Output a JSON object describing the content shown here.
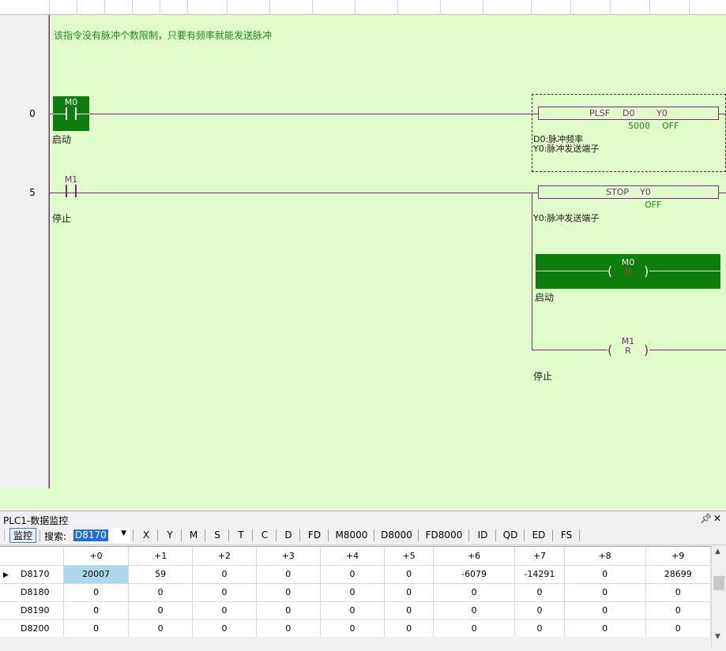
{
  "ladder": {
    "header_comment": "该指令没有脉冲个数限制，只要有频率就能发送脉冲",
    "rungs": [
      {
        "step": "0",
        "contact": {
          "name": "M0",
          "comment": "启动"
        },
        "instruction": {
          "op": "PLSF",
          "arg1": "D0",
          "arg2": "Y0",
          "val1": "5000",
          "val2": "OFF"
        },
        "comments": [
          "D0:脉冲频率",
          "Y0:脉冲发送端子"
        ]
      },
      {
        "step": "5",
        "contact": {
          "name": "M1",
          "comment": "停止"
        },
        "instruction": {
          "op": "STOP",
          "arg1": "Y0",
          "val1": "OFF"
        },
        "comments": [
          "Y0:脉冲发送端子"
        ],
        "coils": [
          {
            "name": "M0",
            "type": "R",
            "comment": "启动"
          },
          {
            "name": "M1",
            "type": "R",
            "comment": "停止"
          }
        ]
      }
    ]
  },
  "monitor": {
    "title": "PLC1-数据监控",
    "pin_icon": "pin-icon",
    "close_icon": "close-icon",
    "pin_glyph": "ᅟ",
    "close_glyph": "✕",
    "monitor_btn": "监控",
    "search_label": "搜索:",
    "search_value": "D8170",
    "filters": [
      "X",
      "Y",
      "M",
      "S",
      "T",
      "C",
      "D",
      "FD",
      "M8000",
      "D8000",
      "FD8000",
      "ID",
      "QD",
      "ED",
      "FS"
    ],
    "columns": [
      "+0",
      "+1",
      "+2",
      "+3",
      "+4",
      "+5",
      "+6",
      "+7",
      "+8",
      "+9"
    ],
    "rows": [
      {
        "addr": "D8170",
        "values": [
          "20007",
          "59",
          "0",
          "0",
          "0",
          "0",
          "-6079",
          "-14291",
          "0",
          "28699"
        ]
      },
      {
        "addr": "D8180",
        "values": [
          "0",
          "0",
          "0",
          "0",
          "0",
          "0",
          "0",
          "0",
          "0",
          "0"
        ]
      },
      {
        "addr": "D8190",
        "values": [
          "0",
          "0",
          "0",
          "0",
          "0",
          "0",
          "0",
          "0",
          "0",
          "0"
        ]
      },
      {
        "addr": "D8200",
        "values": [
          "0",
          "0",
          "0",
          "0",
          "0",
          "0",
          "0",
          "0",
          "0",
          "0"
        ]
      }
    ],
    "colors": {
      "selected_cell": "#a9d9ec",
      "active_element": "#0d7d0d",
      "ladder_bg": "#e1fccb",
      "wire": "#7a2a7a",
      "comment": "#1c8a1c"
    }
  }
}
